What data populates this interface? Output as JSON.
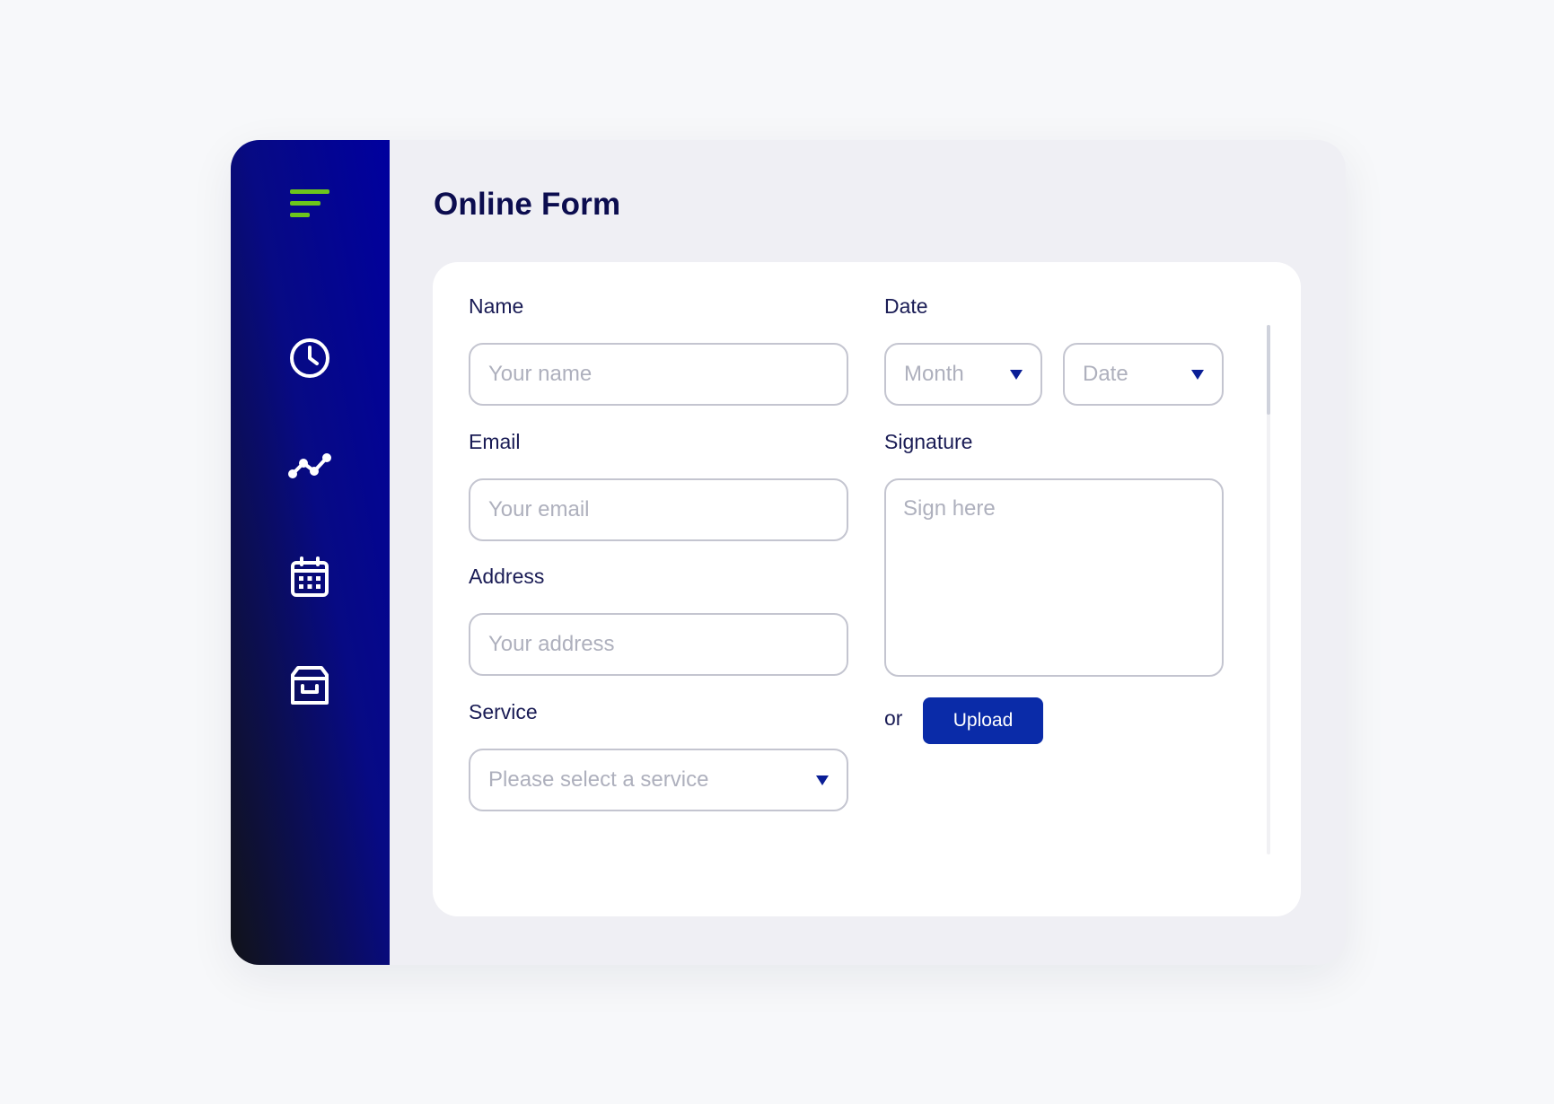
{
  "theme": {
    "accent": "#0a2ba8",
    "menu_accent": "#6cc51c",
    "title_color": "#0c0d4f",
    "arrow_color": "#0a1e96"
  },
  "sidebar": {
    "menu_icon": "hamburger-menu-icon",
    "items": [
      {
        "icon": "clock-icon",
        "label": "History"
      },
      {
        "icon": "chart-line-icon",
        "label": "Analytics"
      },
      {
        "icon": "calendar-icon",
        "label": "Calendar"
      },
      {
        "icon": "archive-icon",
        "label": "Archive"
      }
    ]
  },
  "form": {
    "title": "Online Form",
    "name": {
      "label": "Name",
      "placeholder": "Your name"
    },
    "email": {
      "label": "Email",
      "placeholder": "Your email"
    },
    "address": {
      "label": "Address",
      "placeholder": "Your address"
    },
    "service": {
      "label": "Service",
      "placeholder": "Please select a service"
    },
    "date": {
      "label": "Date",
      "month_placeholder": "Month",
      "date_placeholder": "Date"
    },
    "signature": {
      "label": "Signature",
      "placeholder": "Sign here"
    },
    "upload": {
      "or_text": "or",
      "button_label": "Upload"
    }
  }
}
